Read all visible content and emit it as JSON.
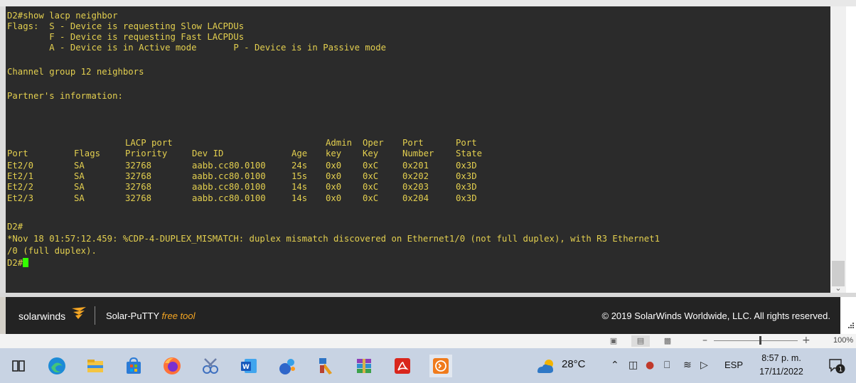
{
  "terminal": {
    "command_line": "D2#show lacp neighbor",
    "flags_line1": "Flags:  S - Device is requesting Slow LACPDUs",
    "flags_line2": "        F - Device is requesting Fast LACPDUs",
    "flags_line3": "        A - Device is in Active mode       P - Device is in Passive mode",
    "channel_group": "Channel group 12 neighbors",
    "partner_info": "Partner's information:",
    "header_row1": [
      "",
      "",
      "LACP port",
      "",
      "",
      "Admin",
      "Oper",
      "Port",
      "Port"
    ],
    "header_row2": [
      "Port",
      "Flags",
      "Priority",
      "Dev ID",
      "Age",
      "key",
      "Key",
      "Number",
      "State"
    ],
    "rows": [
      [
        "Et2/0",
        "SA",
        "32768",
        "aabb.cc80.0100",
        "24s",
        "0x0",
        "0xC",
        "0x201",
        "0x3D"
      ],
      [
        "Et2/1",
        "SA",
        "32768",
        "aabb.cc80.0100",
        "15s",
        "0x0",
        "0xC",
        "0x202",
        "0x3D"
      ],
      [
        "Et2/2",
        "SA",
        "32768",
        "aabb.cc80.0100",
        "14s",
        "0x0",
        "0xC",
        "0x203",
        "0x3D"
      ],
      [
        "Et2/3",
        "SA",
        "32768",
        "aabb.cc80.0100",
        "14s",
        "0x0",
        "0xC",
        "0x204",
        "0x3D"
      ]
    ],
    "prompt1": "D2#",
    "log_line1": "*Nov 18 01:57:12.459: %CDP-4-DUPLEX_MISMATCH: duplex mismatch discovered on Ethernet1/0 (not full duplex), with R3 Ethernet1",
    "log_line2": "/0 (full duplex).",
    "prompt2": "D2#"
  },
  "footer": {
    "brand": "solarwinds",
    "app_name": "Solar-PuTTY",
    "free_tag": "free tool",
    "copyright": "© 2019 SolarWinds Worldwide, LLC. All rights reserved."
  },
  "statusbar": {
    "zoom_level": "100%",
    "zoom_fraction": 0.55
  },
  "taskbar": {
    "icons": [
      "task-view-icon",
      "edge-icon",
      "file-explorer-icon",
      "microsoft-store-icon",
      "firefox-icon",
      "snipping-tool-icon",
      "word-icon",
      "chemistry-app-icon",
      "paint-app-icon",
      "winrar-icon",
      "acrobat-reader-icon",
      "solar-putty-icon"
    ],
    "weather_temp": "28°C",
    "language": "ESP",
    "time": "8:57 p. m.",
    "date": "17/11/2022",
    "notification_count": "1"
  },
  "colors": {
    "terminal_bg": "#2b2b2b",
    "terminal_text": "#e3cf4f",
    "cursor": "#33ff00",
    "footer_bg": "#232323",
    "brand_accent": "#f5a623",
    "taskbar_bg": "#c8d3e3"
  }
}
